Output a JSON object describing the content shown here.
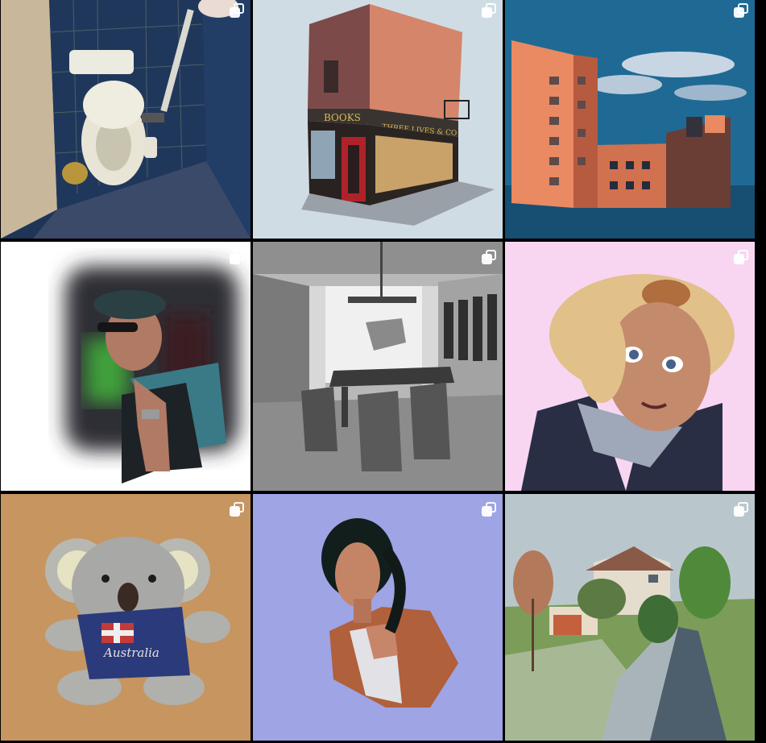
{
  "grid": {
    "posts": [
      {
        "subject": "bathroom-toilet",
        "bg": "#1f3558",
        "multi": true
      },
      {
        "subject": "bookshop-corner",
        "bg": "#cfdce4",
        "multi": true,
        "sign_left": "BOOKS",
        "sign_right": "THREE LIVES & CO"
      },
      {
        "subject": "apartment-blocks",
        "bg": "#1f6a94",
        "multi": true
      },
      {
        "subject": "man-cap-sunglasses",
        "bg": "#ffffff",
        "multi": true
      },
      {
        "subject": "grey-dining-room",
        "bg": "#b8b8b8",
        "multi": true
      },
      {
        "subject": "blonde-woman-portrait",
        "bg": "#f8d6f2",
        "multi": true
      },
      {
        "subject": "koala-plush",
        "bg": "#c79560",
        "multi": true,
        "shirt_text": "Australia"
      },
      {
        "subject": "woman-braid",
        "bg": "#9ea4e4",
        "multi": true
      },
      {
        "subject": "village-road",
        "bg": "#b9c7cd",
        "multi": true
      }
    ]
  }
}
